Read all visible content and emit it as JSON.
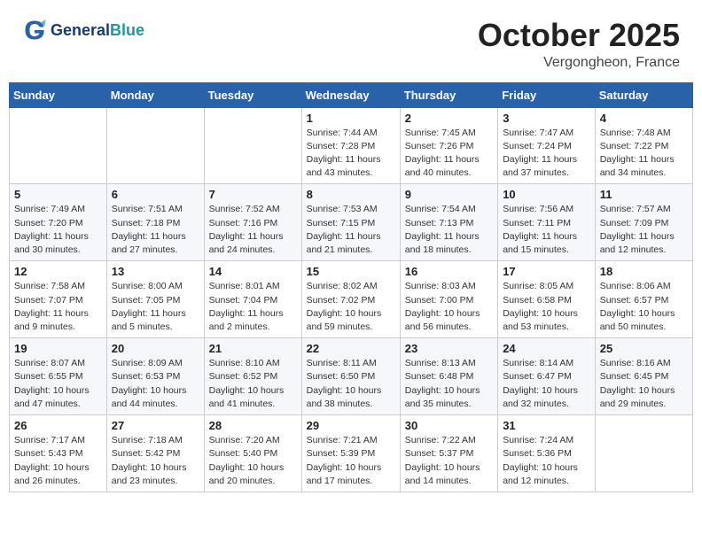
{
  "header": {
    "logo_line1": "General",
    "logo_line2": "Blue",
    "month": "October 2025",
    "location": "Vergongheon, France"
  },
  "weekdays": [
    "Sunday",
    "Monday",
    "Tuesday",
    "Wednesday",
    "Thursday",
    "Friday",
    "Saturday"
  ],
  "weeks": [
    [
      {
        "day": "",
        "info": ""
      },
      {
        "day": "",
        "info": ""
      },
      {
        "day": "",
        "info": ""
      },
      {
        "day": "1",
        "info": "Sunrise: 7:44 AM\nSunset: 7:28 PM\nDaylight: 11 hours and 43 minutes."
      },
      {
        "day": "2",
        "info": "Sunrise: 7:45 AM\nSunset: 7:26 PM\nDaylight: 11 hours and 40 minutes."
      },
      {
        "day": "3",
        "info": "Sunrise: 7:47 AM\nSunset: 7:24 PM\nDaylight: 11 hours and 37 minutes."
      },
      {
        "day": "4",
        "info": "Sunrise: 7:48 AM\nSunset: 7:22 PM\nDaylight: 11 hours and 34 minutes."
      }
    ],
    [
      {
        "day": "5",
        "info": "Sunrise: 7:49 AM\nSunset: 7:20 PM\nDaylight: 11 hours and 30 minutes."
      },
      {
        "day": "6",
        "info": "Sunrise: 7:51 AM\nSunset: 7:18 PM\nDaylight: 11 hours and 27 minutes."
      },
      {
        "day": "7",
        "info": "Sunrise: 7:52 AM\nSunset: 7:16 PM\nDaylight: 11 hours and 24 minutes."
      },
      {
        "day": "8",
        "info": "Sunrise: 7:53 AM\nSunset: 7:15 PM\nDaylight: 11 hours and 21 minutes."
      },
      {
        "day": "9",
        "info": "Sunrise: 7:54 AM\nSunset: 7:13 PM\nDaylight: 11 hours and 18 minutes."
      },
      {
        "day": "10",
        "info": "Sunrise: 7:56 AM\nSunset: 7:11 PM\nDaylight: 11 hours and 15 minutes."
      },
      {
        "day": "11",
        "info": "Sunrise: 7:57 AM\nSunset: 7:09 PM\nDaylight: 11 hours and 12 minutes."
      }
    ],
    [
      {
        "day": "12",
        "info": "Sunrise: 7:58 AM\nSunset: 7:07 PM\nDaylight: 11 hours and 9 minutes."
      },
      {
        "day": "13",
        "info": "Sunrise: 8:00 AM\nSunset: 7:05 PM\nDaylight: 11 hours and 5 minutes."
      },
      {
        "day": "14",
        "info": "Sunrise: 8:01 AM\nSunset: 7:04 PM\nDaylight: 11 hours and 2 minutes."
      },
      {
        "day": "15",
        "info": "Sunrise: 8:02 AM\nSunset: 7:02 PM\nDaylight: 10 hours and 59 minutes."
      },
      {
        "day": "16",
        "info": "Sunrise: 8:03 AM\nSunset: 7:00 PM\nDaylight: 10 hours and 56 minutes."
      },
      {
        "day": "17",
        "info": "Sunrise: 8:05 AM\nSunset: 6:58 PM\nDaylight: 10 hours and 53 minutes."
      },
      {
        "day": "18",
        "info": "Sunrise: 8:06 AM\nSunset: 6:57 PM\nDaylight: 10 hours and 50 minutes."
      }
    ],
    [
      {
        "day": "19",
        "info": "Sunrise: 8:07 AM\nSunset: 6:55 PM\nDaylight: 10 hours and 47 minutes."
      },
      {
        "day": "20",
        "info": "Sunrise: 8:09 AM\nSunset: 6:53 PM\nDaylight: 10 hours and 44 minutes."
      },
      {
        "day": "21",
        "info": "Sunrise: 8:10 AM\nSunset: 6:52 PM\nDaylight: 10 hours and 41 minutes."
      },
      {
        "day": "22",
        "info": "Sunrise: 8:11 AM\nSunset: 6:50 PM\nDaylight: 10 hours and 38 minutes."
      },
      {
        "day": "23",
        "info": "Sunrise: 8:13 AM\nSunset: 6:48 PM\nDaylight: 10 hours and 35 minutes."
      },
      {
        "day": "24",
        "info": "Sunrise: 8:14 AM\nSunset: 6:47 PM\nDaylight: 10 hours and 32 minutes."
      },
      {
        "day": "25",
        "info": "Sunrise: 8:16 AM\nSunset: 6:45 PM\nDaylight: 10 hours and 29 minutes."
      }
    ],
    [
      {
        "day": "26",
        "info": "Sunrise: 7:17 AM\nSunset: 5:43 PM\nDaylight: 10 hours and 26 minutes."
      },
      {
        "day": "27",
        "info": "Sunrise: 7:18 AM\nSunset: 5:42 PM\nDaylight: 10 hours and 23 minutes."
      },
      {
        "day": "28",
        "info": "Sunrise: 7:20 AM\nSunset: 5:40 PM\nDaylight: 10 hours and 20 minutes."
      },
      {
        "day": "29",
        "info": "Sunrise: 7:21 AM\nSunset: 5:39 PM\nDaylight: 10 hours and 17 minutes."
      },
      {
        "day": "30",
        "info": "Sunrise: 7:22 AM\nSunset: 5:37 PM\nDaylight: 10 hours and 14 minutes."
      },
      {
        "day": "31",
        "info": "Sunrise: 7:24 AM\nSunset: 5:36 PM\nDaylight: 10 hours and 12 minutes."
      },
      {
        "day": "",
        "info": ""
      }
    ]
  ]
}
